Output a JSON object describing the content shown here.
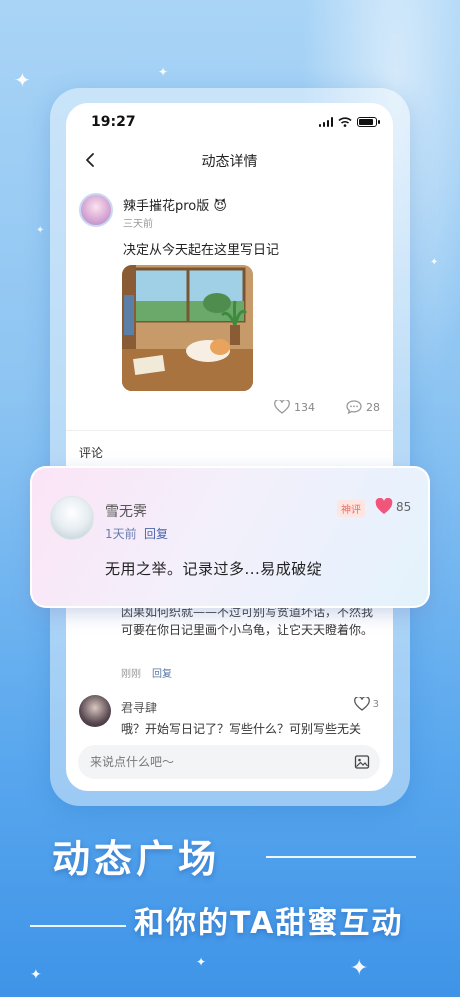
{
  "status_bar": {
    "time": "19:27"
  },
  "nav": {
    "back_icon": "chevron-left-icon",
    "title": "动态详情"
  },
  "post": {
    "author": "辣手摧花pro版 😈",
    "time": "三天前",
    "text": "决定从今天起在这里写日记",
    "likes": "134",
    "comments": "28"
  },
  "comments_section": {
    "header": "评论"
  },
  "featured_comment": {
    "author": "雪无霁",
    "time": "1天前",
    "reply_label": "回复",
    "badge": "神评",
    "likes": "85",
    "text": "无用之举。记录过多...易成破绽"
  },
  "reply_comment": {
    "text": "因果如何织就——不过可别写贫道坏话，不然我可要在你日记里画个小乌龟，让它天天瞪着你。",
    "time": "刚刚",
    "reply_label": "回复"
  },
  "second_comment": {
    "author": "君寻肆",
    "likes": "3",
    "text": "哦？开始写日记了？写些什么？可别写些无关"
  },
  "input": {
    "placeholder": "来说点什么吧～"
  },
  "promo": {
    "line1": "动态广场",
    "line2": "和你的TA甜蜜互动"
  },
  "colors": {
    "accent_pink": "#f2557a",
    "link_blue": "#4a66aa",
    "bg_blue": "#8cc4f2"
  }
}
